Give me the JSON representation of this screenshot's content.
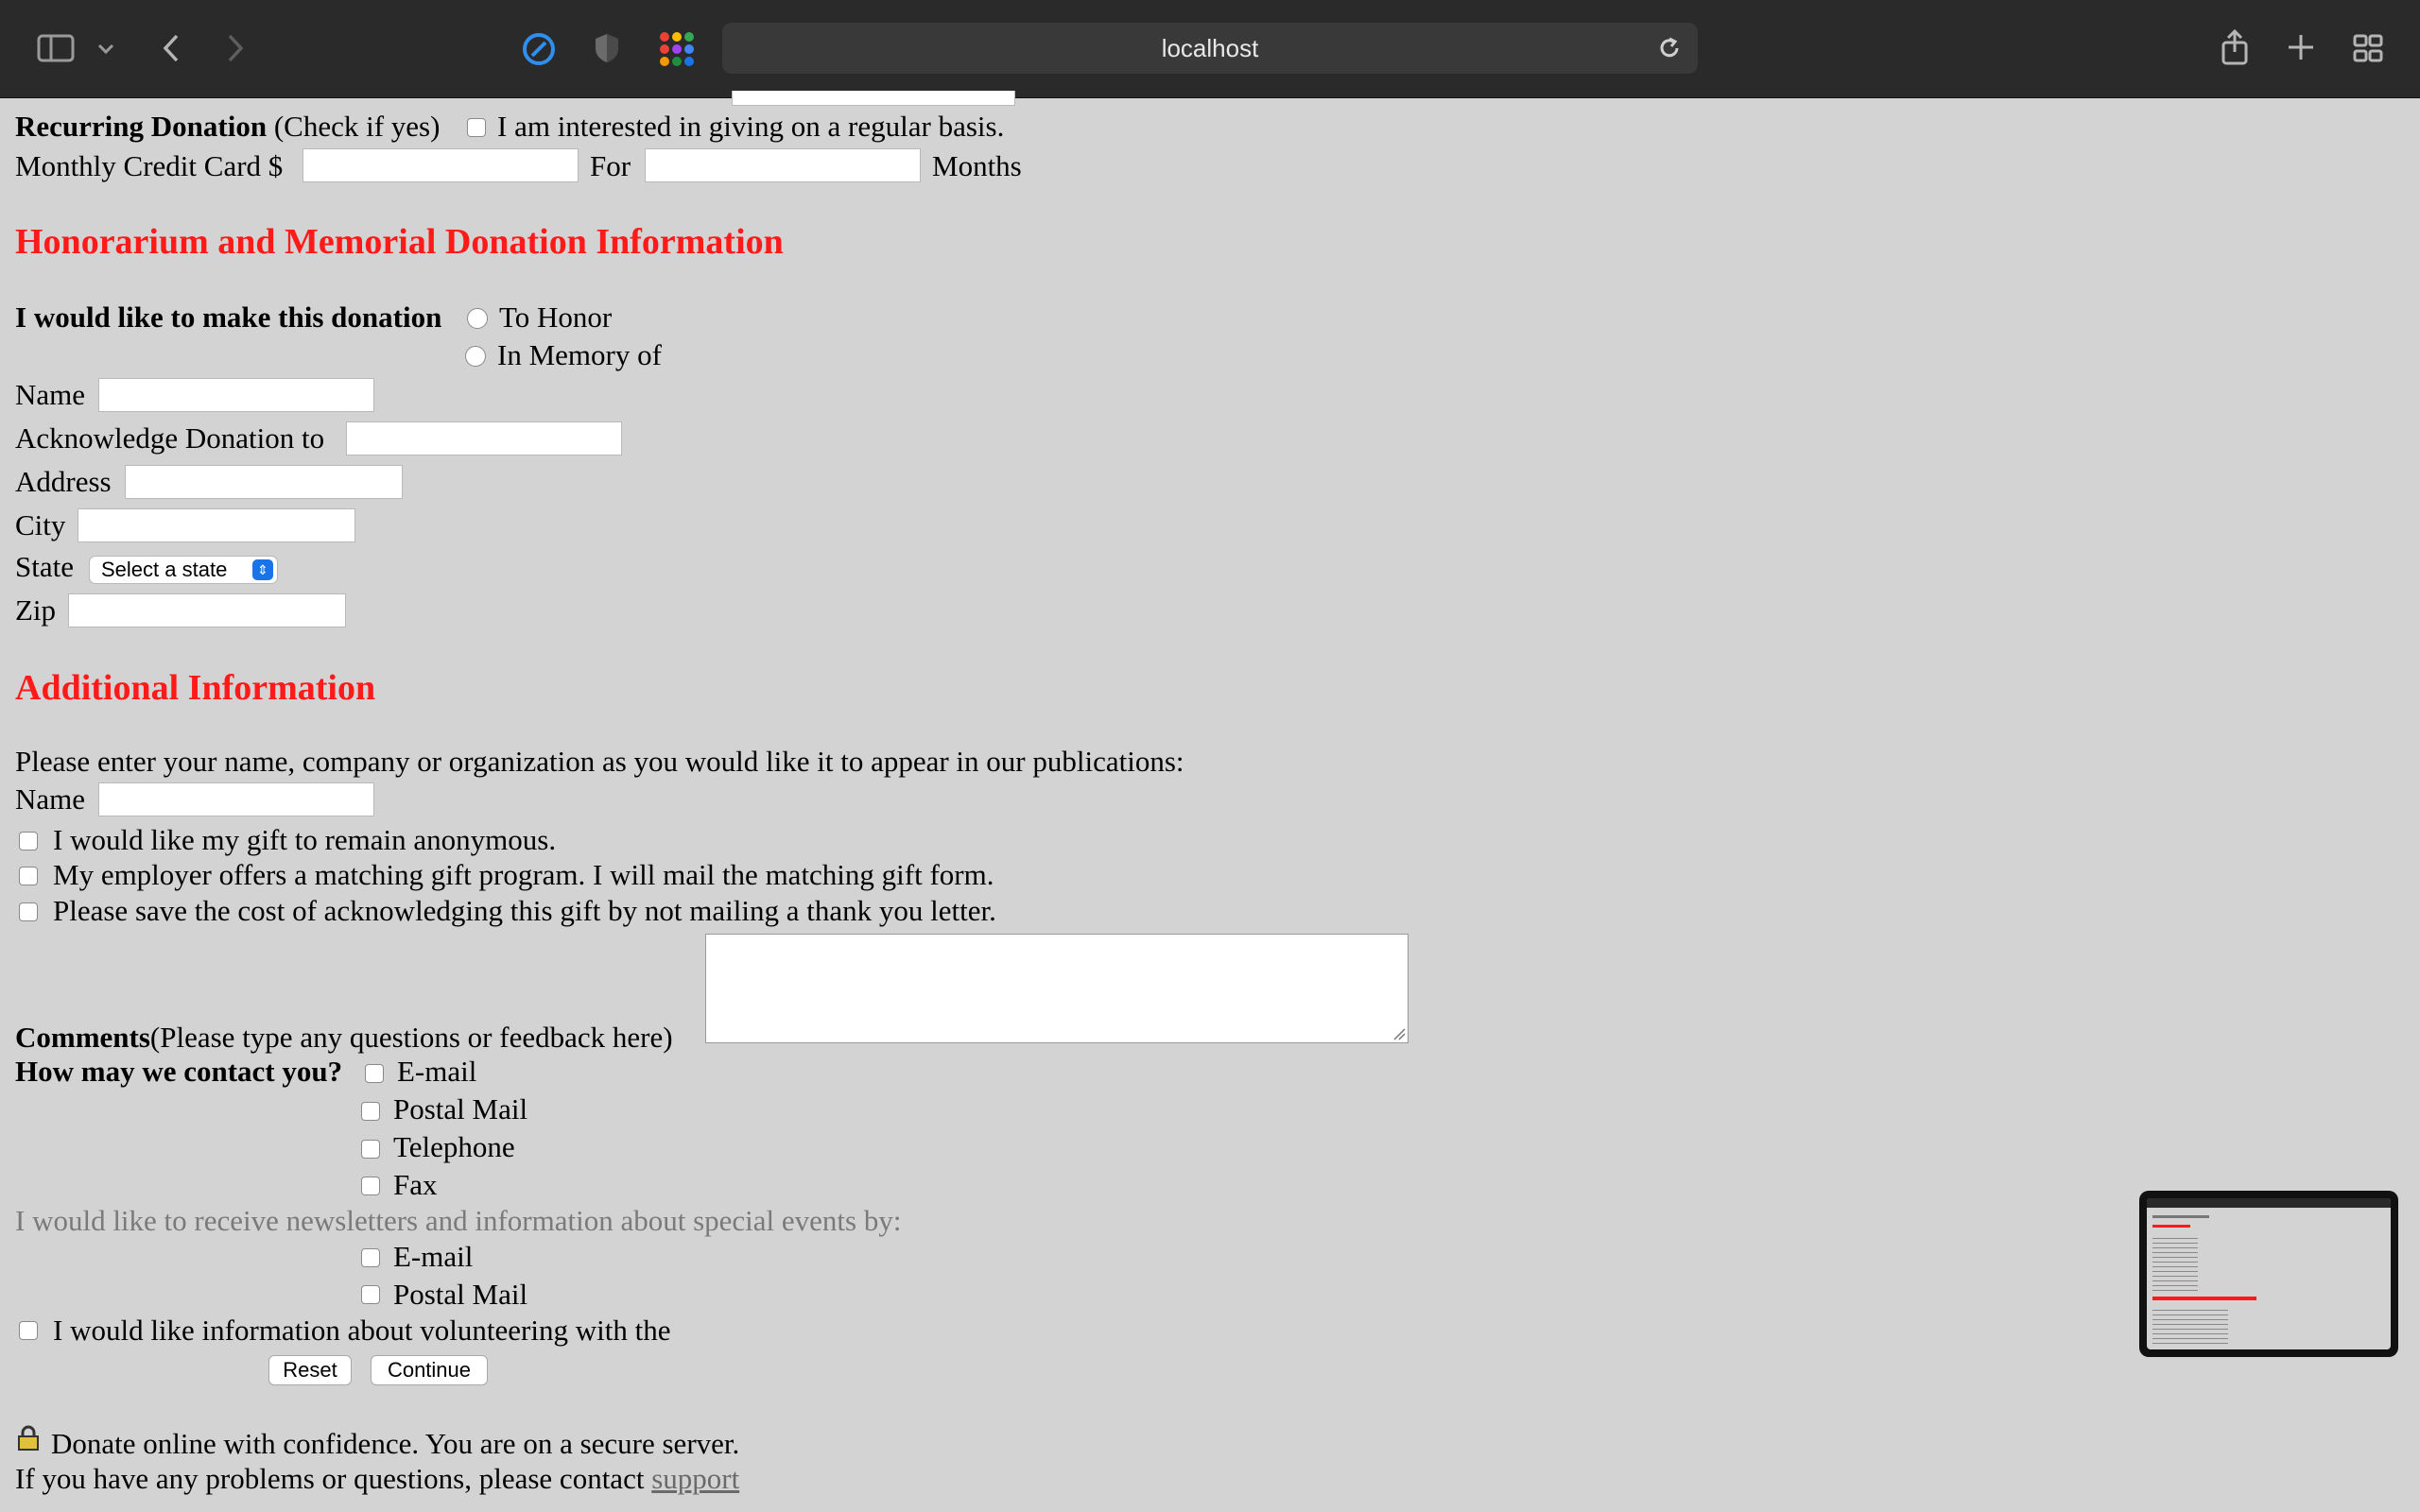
{
  "browser": {
    "url": "localhost",
    "icons": [
      "sidebar-icon",
      "chevron-down-icon",
      "back-icon",
      "forward-icon",
      "compass-icon",
      "shield-icon",
      "grid-dots-icon",
      "reload-icon",
      "share-icon",
      "plus-icon",
      "tabs-overview-icon"
    ]
  },
  "recurring": {
    "label_bold": "Recurring Donation",
    "label_rest": "(Check if yes)",
    "checkbox_label": "I am interested in giving on a regular basis.",
    "monthly_label": "Monthly Credit Card $",
    "for_label": "For",
    "months_label": "Months"
  },
  "honorarium": {
    "heading": "Honorarium and Memorial Donation Information",
    "make_donation_label": "I would like to make this donation",
    "option_honor": "To Honor",
    "option_memory": "In Memory of",
    "name_label": "Name",
    "acknowledge_label": "Acknowledge Donation to",
    "address_label": "Address",
    "city_label": "City",
    "state_label": "State",
    "state_selected": "Select a state",
    "zip_label": "Zip"
  },
  "additional": {
    "heading": "Additional Information",
    "publication_prompt": "Please enter your name, company or organization as you would like it to appear in our publications:",
    "name_label": "Name",
    "anonymous_label": "I would like my gift to remain anonymous.",
    "matching_label": "My employer offers a matching gift program. I will mail the matching gift form.",
    "save_cost_label": "Please save the cost of acknowledging this gift by not mailing a thank you letter.",
    "comments_bold": "Comments",
    "comments_rest": "(Please type any questions or feedback here)",
    "contact_label": "How may we contact you?",
    "contact_email": "E-mail",
    "contact_postal": "Postal Mail",
    "contact_phone": "Telephone",
    "contact_fax": "Fax",
    "newsletter_prompt": "I would like to receive newsletters and information about special events by:",
    "news_email": "E-mail",
    "news_postal": "Postal Mail",
    "volunteer_label": "I would like information about volunteering with the"
  },
  "buttons": {
    "reset": "Reset",
    "continue": "Continue"
  },
  "footer": {
    "secure_text": "Donate online with confidence. You are on a secure server.",
    "problems_text": "If you have any problems or questions, please contact",
    "support_link": "support"
  }
}
